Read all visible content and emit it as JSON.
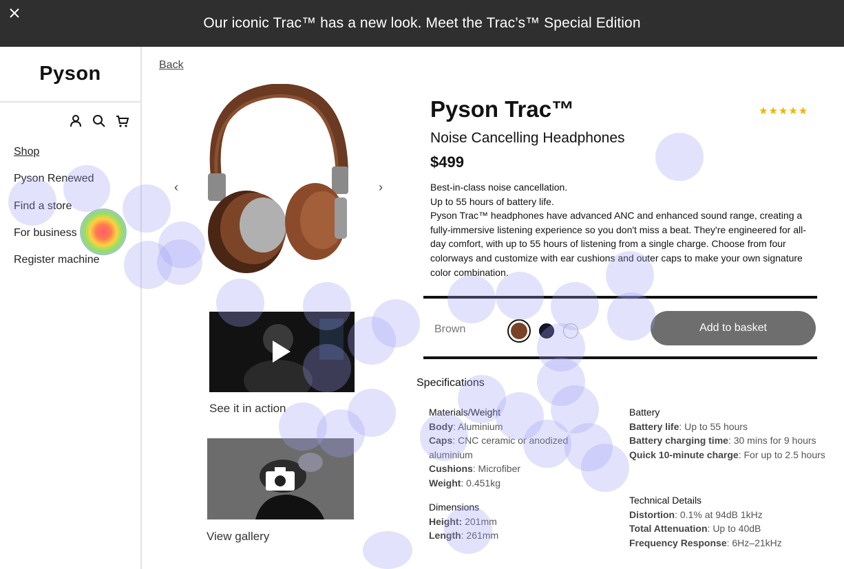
{
  "banner": {
    "text": "Our iconic Trac™ has a new look. Meet the Trac’s™ Special Edition",
    "close_icon": "close-icon"
  },
  "sidebar": {
    "logo": "Pyson",
    "icons": [
      "user-icon",
      "search-icon",
      "cart-icon"
    ],
    "items": [
      {
        "label": "Shop"
      },
      {
        "label": "Pyson Renewed"
      },
      {
        "label": "Find a store"
      },
      {
        "label": "For business"
      },
      {
        "label": "Register machine"
      }
    ]
  },
  "back_link": "Back",
  "gallery": {
    "prev": "‹",
    "next": "›",
    "video_caption": "See it in action",
    "photo_caption": "View gallery"
  },
  "product": {
    "title": "Pyson Trac™",
    "rating_stars": "★★★★★",
    "subtitle": "Noise Cancelling Headphones",
    "price": "$499",
    "description": [
      "Best-in-class noise cancellation.",
      "Up to 55 hours of battery life.",
      "Pyson Trac™ headphones have advanced ANC and enhanced sound range, creating a fully-immersive listening experience so you don't miss a beat. They're engineered for all-day comfort, with up to 55 hours of listening from a single charge. Choose from four colorways and customize with ear cushions and outer caps to make your own signature color combination."
    ],
    "selected_color": "Brown",
    "swatch_colors": [
      "#7a4226",
      "#14142a",
      "#ffffff"
    ],
    "add_to_basket": "Add to basket"
  },
  "specs": {
    "title": "Specifications",
    "materials": {
      "heading": "Materials/Weight",
      "rows": [
        {
          "k": "Body",
          "v": ": Aluminium"
        },
        {
          "k": "Caps",
          "v": ": CNC ceramic or anodized aluminium"
        },
        {
          "k": "Cushions",
          "v": ": Microfiber"
        },
        {
          "k": "Weight",
          "v": ": 0.451kg"
        }
      ]
    },
    "dimensions": {
      "heading": "Dimensions",
      "rows": [
        {
          "k": "Height:",
          "v": " 201mm"
        },
        {
          "k": "Length",
          "v": ": 261mm"
        }
      ]
    },
    "battery": {
      "heading": "Battery",
      "rows": [
        {
          "k": "Battery life",
          "v": ": Up to 55 hours"
        },
        {
          "k": "Battery charging time",
          "v": ": 30 mins for 9 hours"
        },
        {
          "k": "Quick 10-minute charge",
          "v": ": For up to 2.5 hours"
        }
      ]
    },
    "technical": {
      "heading": "Technical Details",
      "rows": [
        {
          "k": "Distortion",
          "v": ": 0.1% at 94dB 1kHz"
        },
        {
          "k": "Total Attenuation",
          "v": ": Up to 40dB"
        },
        {
          "k": "Frequency Response",
          "v": ": 6Hz–21kHz"
        }
      ]
    }
  }
}
